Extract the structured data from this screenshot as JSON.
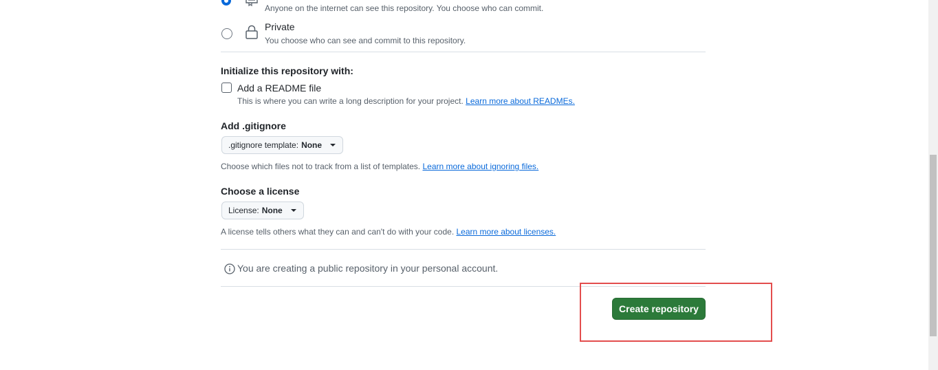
{
  "visibility": {
    "public_desc": "Anyone on the internet can see this repository. You choose who can commit.",
    "private_label": "Private",
    "private_desc": "You choose who can see and commit to this repository."
  },
  "initialize": {
    "heading": "Initialize this repository with:",
    "readme_label": "Add a README file",
    "readme_desc": "This is where you can write a long description for your project.",
    "readme_link": "Learn more about READMEs."
  },
  "gitignore": {
    "heading": "Add .gitignore",
    "dropdown_prefix": ".gitignore template:",
    "dropdown_value": "None",
    "help": "Choose which files not to track from a list of templates.",
    "help_link": "Learn more about ignoring files."
  },
  "license": {
    "heading": "Choose a license",
    "dropdown_prefix": "License:",
    "dropdown_value": "None",
    "help": "A license tells others what they can and can't do with your code.",
    "help_link": "Learn more about licenses."
  },
  "notice": {
    "text": "You are creating a public repository in your personal account."
  },
  "actions": {
    "create_label": "Create repository"
  },
  "colors": {
    "accent": "#0969da",
    "create_button": "#2c7a3a",
    "highlight_box": "#e34d4d"
  }
}
